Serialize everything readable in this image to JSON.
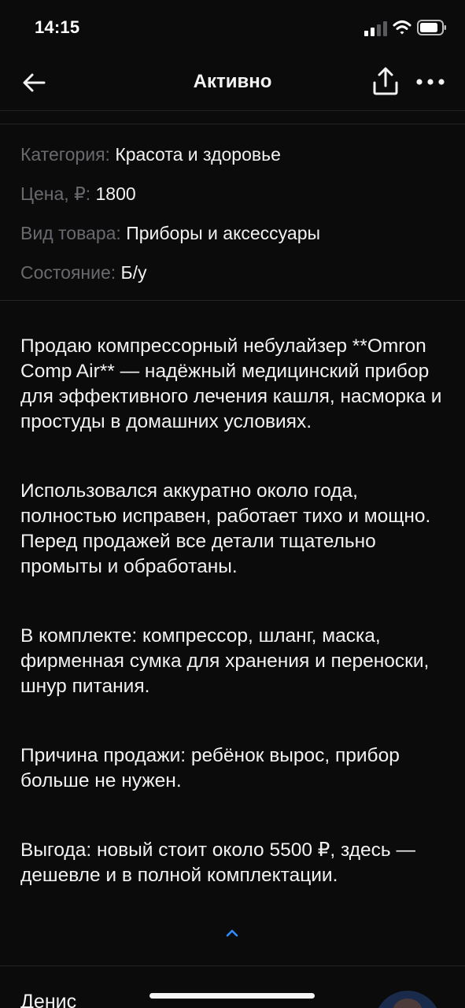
{
  "status_bar": {
    "time": "14:15"
  },
  "nav": {
    "title": "Активно",
    "icons": [
      "back-arrow-icon",
      "share-icon",
      "more-icon"
    ]
  },
  "params": [
    {
      "label": "Категория:",
      "value": "Красота и здоровье"
    },
    {
      "label": "Цена, ₽:",
      "value": "1800"
    },
    {
      "label": "Вид товара:",
      "value": "Приборы и аксессуары"
    },
    {
      "label": "Состояние:",
      "value": "Б/у"
    }
  ],
  "description": {
    "paragraphs": [
      "Продаю компрессорный небулайзер **Omron Comp Air** — надёжный медицинский прибор для эффективного лечения кашля, насморка и простуды в домашних условиях.",
      "Использовался аккуратно около года, полностью исправен, работает тихо и мощно. Перед продажей все детали тщательно промыты и обработаны.",
      "В комплекте: компрессор, шланг, маска, фирменная сумка для хранения и переноски, шнур питания.",
      "Причина продажи: ребёнок вырос, прибор больше не нужен.",
      "Выгода: новый стоит около 5500 ₽, здесь — дешевле и в полной комплектации."
    ]
  },
  "seller": {
    "name": "Денис"
  },
  "colors": {
    "background": "#0b0b0c",
    "text": "#f2f2f2",
    "label": "#6a6a6e",
    "accent": "#2f8cff",
    "divider": "#242426"
  }
}
